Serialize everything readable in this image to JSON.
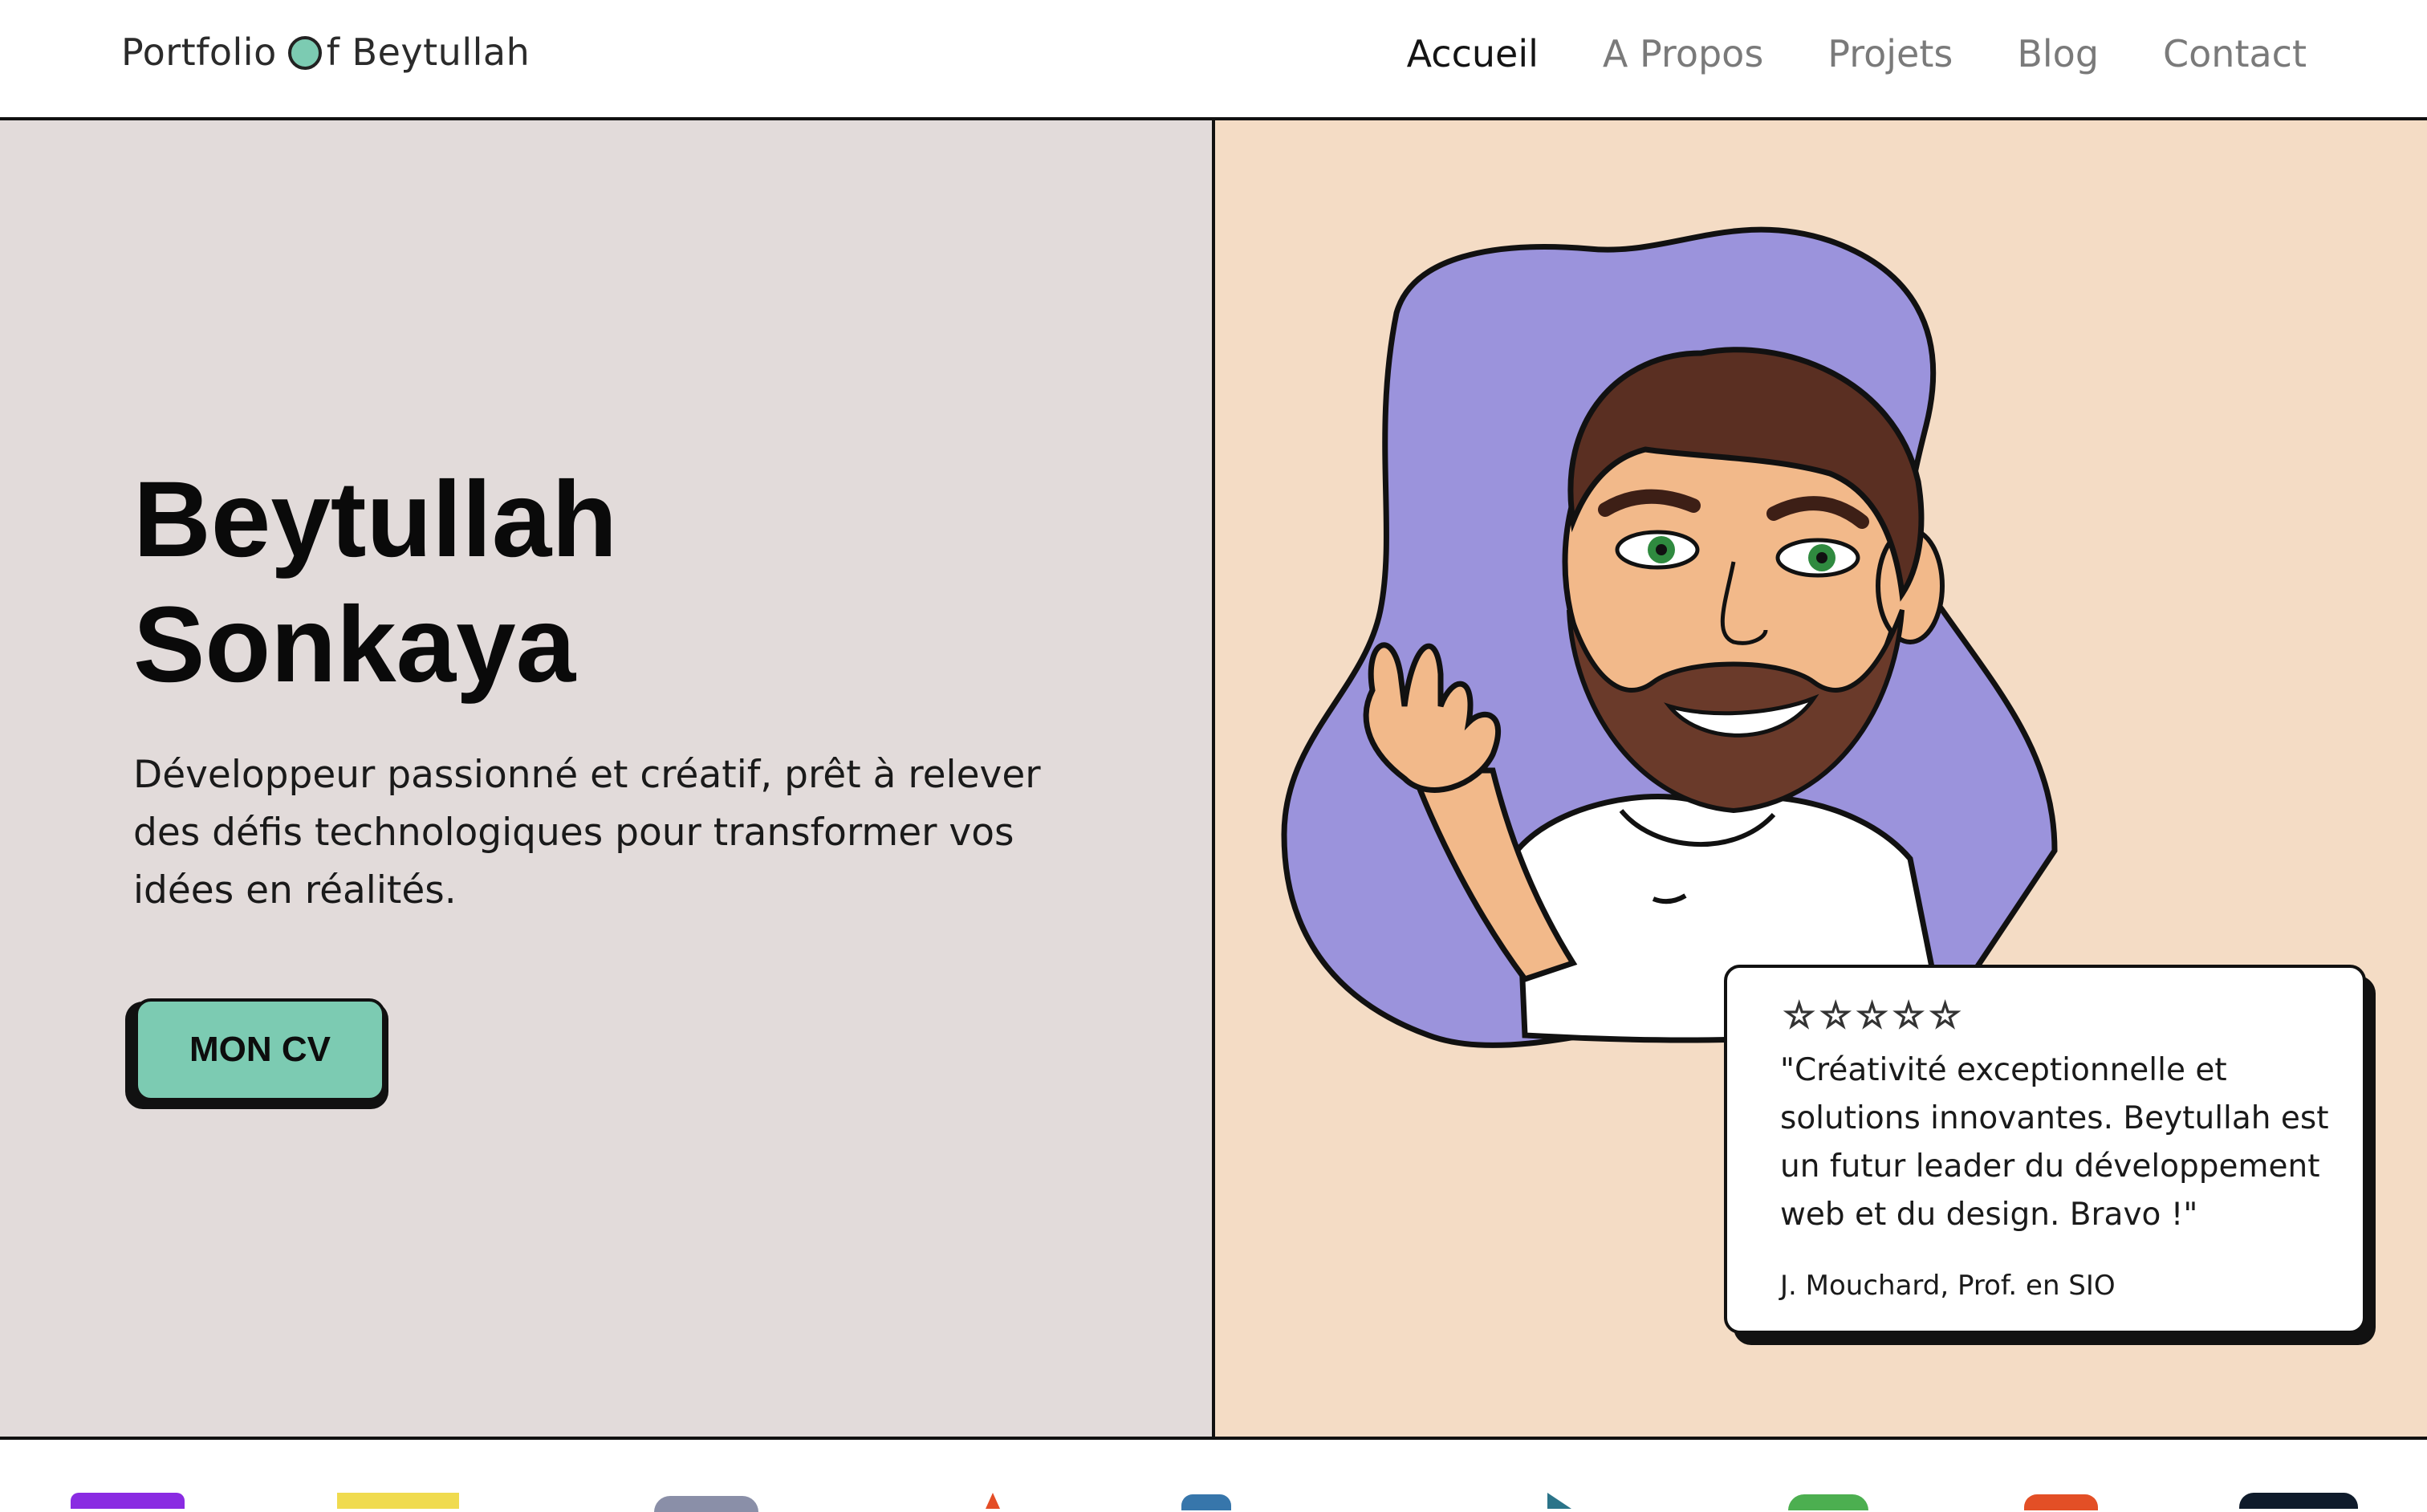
{
  "header": {
    "logo_prefix": "Portfolio ",
    "logo_o": "O",
    "logo_suffix": "f Beytullah",
    "nav": [
      {
        "label": "Accueil",
        "active": true
      },
      {
        "label": "A Propos",
        "active": false
      },
      {
        "label": "Projets",
        "active": false
      },
      {
        "label": "Blog",
        "active": false
      },
      {
        "label": "Contact",
        "active": false
      }
    ]
  },
  "hero": {
    "first_name": "Beytullah",
    "last_name": "Sonkaya",
    "tagline": "Développeur passionné et créatif, prêt à relever des défis technologiques pour transformer vos idées en réalités.",
    "cv_button": "MON CV"
  },
  "testimonial": {
    "stars": 5,
    "star_glyph": "☆",
    "quote": "\"Créativité exceptionnelle et solutions innovantes. Beytullah est un futur leader du développement web et du design. Bravo !\"",
    "author": "J. Mouchard, Prof. en SIO"
  },
  "colors": {
    "accent": "#7ccbb2",
    "hero_left_bg": "#e2dbda",
    "hero_right_bg": "#f4dcc5",
    "avatar_blob": "#9b93dc"
  },
  "tech_icons": [
    {
      "name": "purple-tech-icon",
      "color": "#8a2be2"
    },
    {
      "name": "yellow-tech-icon",
      "color": "#f0db4f"
    },
    {
      "name": "gray-tech-icon",
      "color": "#8a8fa8"
    },
    {
      "name": "red-tech-icon",
      "color": "#e44d26"
    },
    {
      "name": "blue-tech-icon",
      "color": "#3776ab"
    },
    {
      "name": "teal-tech-icon",
      "color": "#2b7489"
    },
    {
      "name": "green-tech-icon",
      "color": "#4caf50"
    },
    {
      "name": "orange-tech-icon",
      "color": "#e34f26"
    },
    {
      "name": "dark-tech-icon",
      "color": "#0f1b2b"
    }
  ]
}
